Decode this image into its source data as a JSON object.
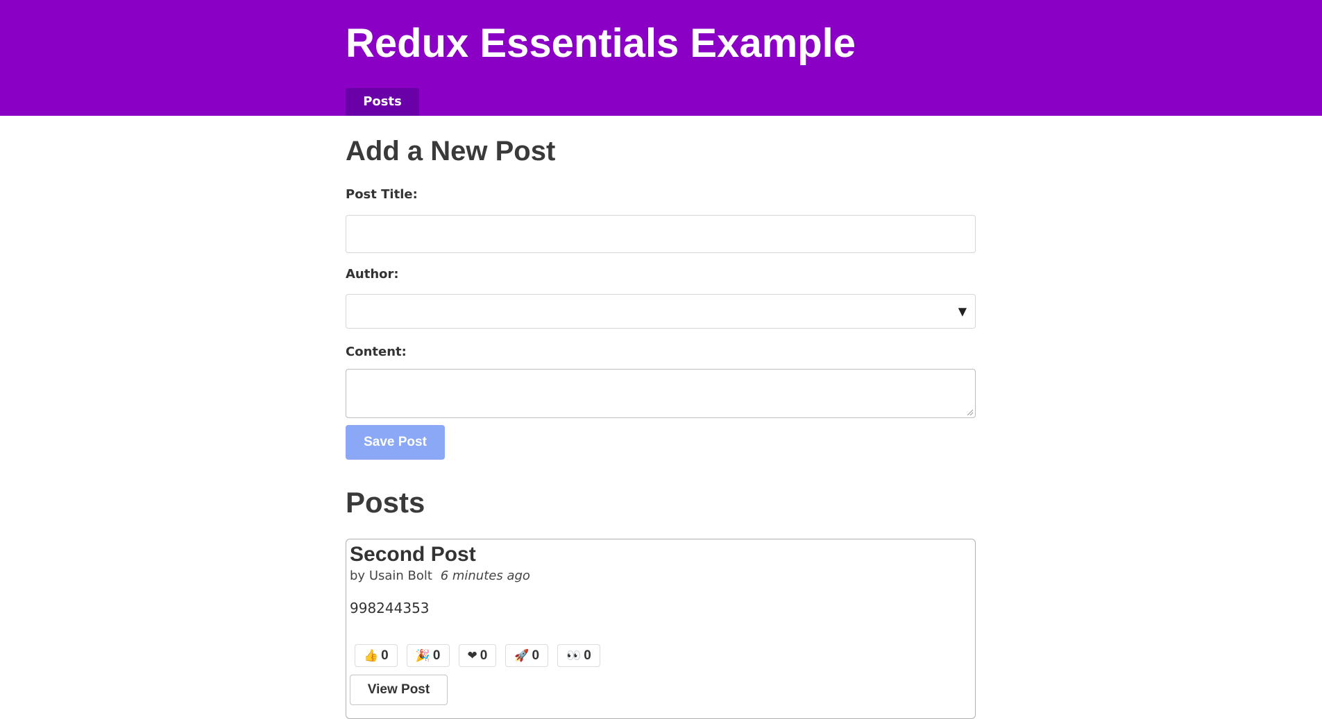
{
  "header": {
    "title": "Redux Essentials Example",
    "nav": {
      "posts_label": "Posts"
    }
  },
  "form": {
    "title": "Add a New Post",
    "post_title_label": "Post Title:",
    "post_title_value": "",
    "author_label": "Author:",
    "author_selected": "",
    "content_label": "Content:",
    "content_value": "",
    "save_label": "Save Post",
    "save_enabled": false
  },
  "posts": {
    "heading": "Posts",
    "items": [
      {
        "title": "Second Post",
        "author_prefix": "by",
        "author": "Usain Bolt",
        "time": "6 minutes ago",
        "content": "998244353",
        "reactions": [
          {
            "icon": "thumbs-up-icon",
            "glyph": "👍",
            "count": "0"
          },
          {
            "icon": "party-popper-icon",
            "glyph": "🎉",
            "count": "0"
          },
          {
            "icon": "heart-icon",
            "glyph": "❤",
            "count": "0"
          },
          {
            "icon": "rocket-icon",
            "glyph": "🚀",
            "count": "0"
          },
          {
            "icon": "eyes-icon",
            "glyph": "👀",
            "count": "0"
          }
        ],
        "view_label": "View Post"
      }
    ]
  },
  "colors": {
    "header_bg": "#8a00c4",
    "nav_active_bg": "#6a00a8",
    "save_button_disabled": "#8aa8f5"
  }
}
